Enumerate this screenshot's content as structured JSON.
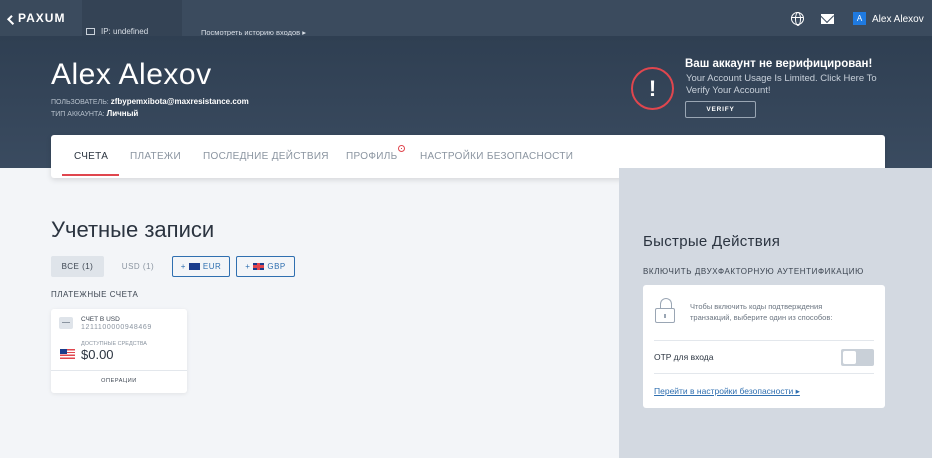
{
  "topbar": {
    "brand": "PAXUM",
    "ip_text": "IP: undefined",
    "history_link": "Посмотреть историю входов ▸",
    "user_initial": "A",
    "user_name": "Alex Alexov"
  },
  "hero": {
    "name": "Alex Alexov",
    "user_label": "ПОЛЬЗОВАТЕЛЬ:",
    "user_value": "zfbypemxibota@maxresistance.com",
    "type_label": "ТИП АККАУНТА:",
    "type_value": "Личный"
  },
  "alert": {
    "symbol": "!",
    "title": "Ваш аккаунт не верифицирован!",
    "text": "Your Account Usage Is Limited. Click Here To Verify Your Account!",
    "verify_label": "VERIFY"
  },
  "tabs": [
    {
      "label": "СЧЕТА"
    },
    {
      "label": "ПЛАТЕЖИ"
    },
    {
      "label": "ПОСЛЕДНИЕ ДЕЙСТВИЯ"
    },
    {
      "label": "ПРОФИЛЬ"
    },
    {
      "label": "НАСТРОЙКИ БЕЗОПАСНОСТИ"
    }
  ],
  "accounts": {
    "title": "Учетные записи",
    "filters": {
      "all": "ВСЕ (1)",
      "usd": "USD (1)",
      "add_prefix": "+",
      "eur": "EUR",
      "gbp": "GBP"
    },
    "payment_label": "ПЛАТЕЖНЫЕ СЧЕТА",
    "card": {
      "name": "СЧЕТ В USD",
      "number": "1211100000948469",
      "available_label": "ДОСТУПНЫЕ СРЕДСТВА",
      "balance": "$0.00",
      "operations": "ОПЕРАЦИИ"
    }
  },
  "quick_actions": {
    "title": "Быстрые Действия",
    "tfa_label": "ВКЛЮЧИТЬ ДВУХФАКТОРНУЮ АУТЕНТИФИКАЦИЮ",
    "tfa_text": "Чтобы включить коды подтверждения транзакций, выберите один из способов:",
    "otp_label": "OTP для входа",
    "otp_enabled": false,
    "security_link": "Перейти в настройки безопасности ▸"
  },
  "colors": {
    "accent_red": "#e0464e",
    "link_blue": "#2f6fb0",
    "header_bg": "#3b4b5e"
  }
}
